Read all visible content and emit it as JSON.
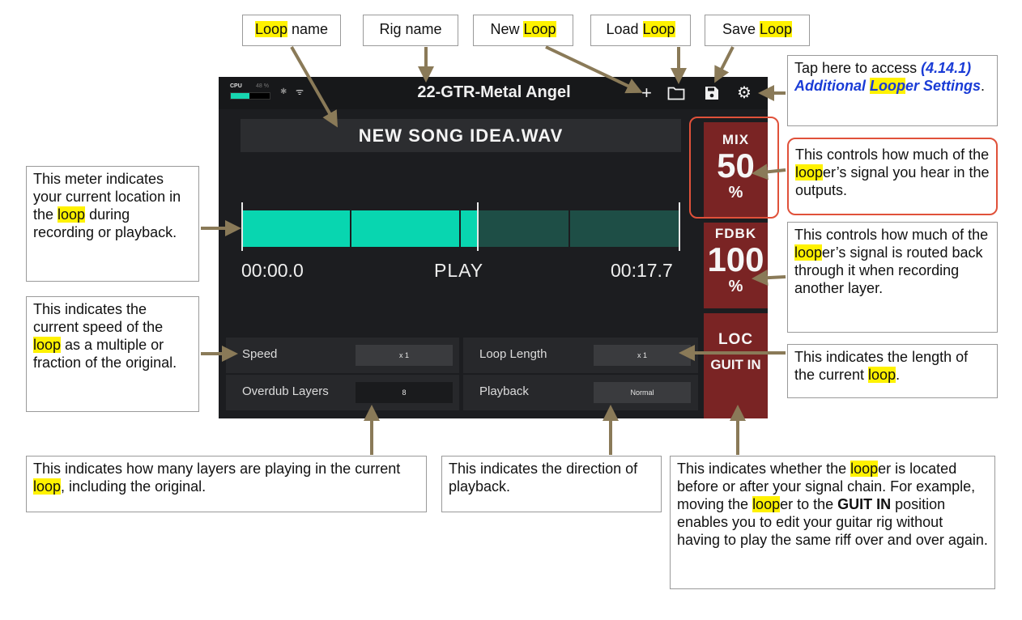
{
  "status_bar": {
    "cpu_label": "CPU",
    "cpu_percent": "48 %",
    "cpu_level": 0.48,
    "bluetooth_icon": "bluetooth-icon",
    "wifi_icon": "wifi-icon"
  },
  "header": {
    "rig_name": "22-GTR-Metal Angel",
    "icons": [
      "plus-icon",
      "folder-icon",
      "save-icon",
      "gear-icon"
    ]
  },
  "loop_name": "NEW SONG IDEA.WAV",
  "meter": {
    "position_fraction": 0.54,
    "start_time": "00:00.0",
    "state": "PLAY",
    "end_time": "00:17.7",
    "fill_color": "#08d6b0",
    "empty_color": "#1e4e46"
  },
  "params": {
    "speed_label": "Speed",
    "speed_value": "x 1",
    "loop_length_label": "Loop Length",
    "loop_length_value": "x 1",
    "overdub_label": "Overdub Layers",
    "overdub_value": "8",
    "playback_label": "Playback",
    "playback_value": "Normal"
  },
  "side_buttons": {
    "mix": {
      "title": "MIX",
      "value": "50",
      "unit": "%"
    },
    "fdbk": {
      "title": "FDBK",
      "value": "100",
      "unit": "%"
    },
    "loc": {
      "title": "LOC",
      "value": "GUIT IN"
    }
  },
  "callouts": {
    "loop_name": {
      "hl": "Loop",
      "rest": " name"
    },
    "rig_name": "Rig name",
    "new_loop": {
      "pre": "New ",
      "hl": "Loop"
    },
    "load_loop": {
      "pre": "Load ",
      "hl": "Loop"
    },
    "save_loop": {
      "pre": "Save ",
      "hl": "Loop"
    },
    "settings": {
      "pre": "Tap here to access ",
      "ref1": "(4.14.1) Additional ",
      "ref_hl": "Loop",
      "ref2": "er Settings",
      "post": "."
    },
    "mix": {
      "pre": "This controls how much of the ",
      "hl": "loop",
      "post": "er’s signal you hear in the outputs."
    },
    "fdbk": {
      "pre": "This controls how much of the ",
      "hl": "loop",
      "post": "er’s signal is routed back through it when recording another layer."
    },
    "length": {
      "pre": "This indicates the length of the current ",
      "hl": "loop",
      "post": "."
    },
    "meter": {
      "pre": "This meter indicates your current location in the ",
      "hl": "loop",
      "post": " during recording or playback."
    },
    "speed": {
      "pre": "This indicates the current speed of the ",
      "hl": "loop",
      "post": " as a multiple or fraction of the original."
    },
    "overdub": {
      "pre": "This indicates how many layers are playing in the current ",
      "hl": "loop",
      "post": ", including the original."
    },
    "direction": "This indicates the direction of playback.",
    "location": {
      "pre": "This indicates whether the ",
      "hl1": "loop",
      "mid1": "er is located before or after your signal chain. For example, moving the ",
      "hl2": "loop",
      "mid2": "er to the ",
      "bold": "GUIT IN",
      "post": " position enables you to edit your guitar rig without having to play the same riff over and over again."
    }
  },
  "colors": {
    "arrow": "#8a7a58",
    "highlight": "#fff200",
    "red_outline": "#e0513a",
    "button_red": "#7a2424",
    "link_blue": "#1a3cd6"
  }
}
